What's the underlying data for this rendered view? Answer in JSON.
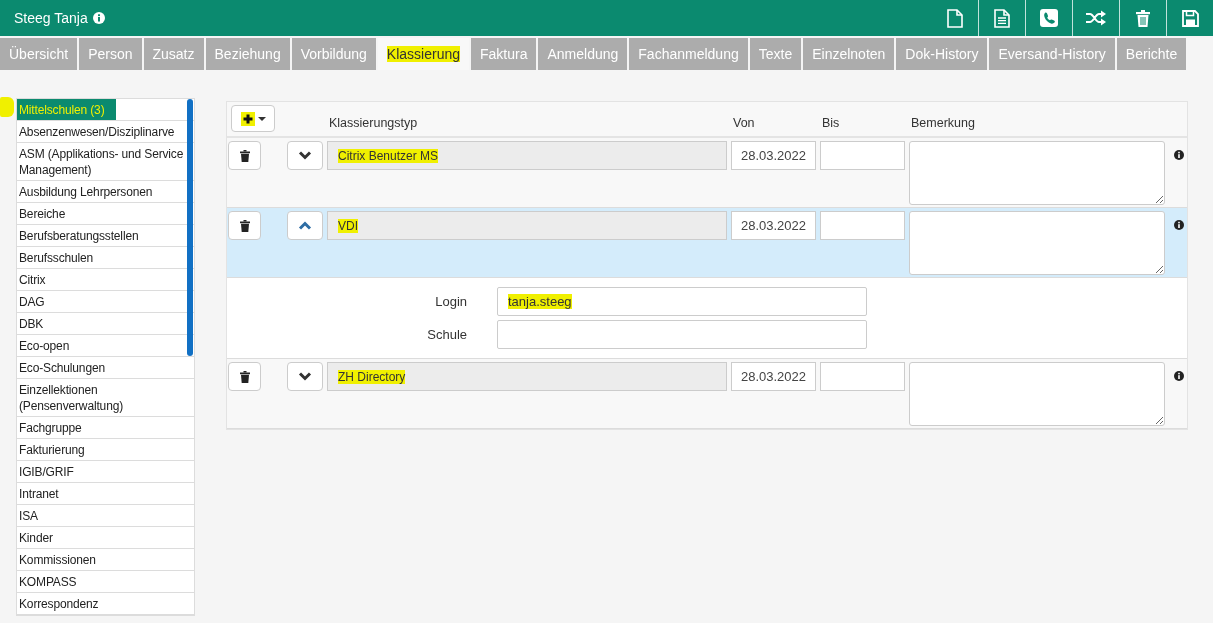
{
  "header": {
    "title": "Steeg Tanja"
  },
  "tabs": [
    {
      "label": "Übersicht",
      "selected": false,
      "highlighted": false
    },
    {
      "label": "Person",
      "selected": false,
      "highlighted": false
    },
    {
      "label": "Zusatz",
      "selected": false,
      "highlighted": false
    },
    {
      "label": "Beziehung",
      "selected": false,
      "highlighted": false
    },
    {
      "label": "Vorbildung",
      "selected": false,
      "highlighted": false
    },
    {
      "label": "Klassierung",
      "selected": true,
      "highlighted": true
    },
    {
      "label": "Faktura",
      "selected": false,
      "highlighted": false
    },
    {
      "label": "Anmeldung",
      "selected": false,
      "highlighted": false
    },
    {
      "label": "Fachanmeldung",
      "selected": false,
      "highlighted": false
    },
    {
      "label": "Texte",
      "selected": false,
      "highlighted": false
    },
    {
      "label": "Einzelnoten",
      "selected": false,
      "highlighted": false
    },
    {
      "label": "Dok-History",
      "selected": false,
      "highlighted": false
    },
    {
      "label": "Eversand-History",
      "selected": false,
      "highlighted": false
    },
    {
      "label": "Berichte",
      "selected": false,
      "highlighted": false
    }
  ],
  "sidebar": {
    "items": [
      {
        "label": "Mittelschulen (3)",
        "selected": true,
        "highlighted": true
      },
      {
        "label": "Absenzenwesen/Disziplinarve",
        "selected": false,
        "highlighted": false
      },
      {
        "label": "ASM (Applikations- und Service Management)",
        "selected": false,
        "highlighted": false
      },
      {
        "label": "Ausbildung Lehrpersonen",
        "selected": false,
        "highlighted": false
      },
      {
        "label": "Bereiche",
        "selected": false,
        "highlighted": false
      },
      {
        "label": "Berufsberatungsstellen",
        "selected": false,
        "highlighted": false
      },
      {
        "label": "Berufsschulen",
        "selected": false,
        "highlighted": false
      },
      {
        "label": "Citrix",
        "selected": false,
        "highlighted": false
      },
      {
        "label": "DAG",
        "selected": false,
        "highlighted": false
      },
      {
        "label": "DBK",
        "selected": false,
        "highlighted": false
      },
      {
        "label": "Eco-open",
        "selected": false,
        "highlighted": false
      },
      {
        "label": "Eco-Schulungen",
        "selected": false,
        "highlighted": false
      },
      {
        "label": "Einzellektionen (Pensenverwaltung)",
        "selected": false,
        "highlighted": false
      },
      {
        "label": "Fachgruppe",
        "selected": false,
        "highlighted": false
      },
      {
        "label": "Fakturierung",
        "selected": false,
        "highlighted": false
      },
      {
        "label": "IGIB/GRIF",
        "selected": false,
        "highlighted": false
      },
      {
        "label": "Intranet",
        "selected": false,
        "highlighted": false
      },
      {
        "label": "ISA",
        "selected": false,
        "highlighted": false
      },
      {
        "label": "Kinder",
        "selected": false,
        "highlighted": false
      },
      {
        "label": "Kommissionen",
        "selected": false,
        "highlighted": false
      },
      {
        "label": "KOMPASS",
        "selected": false,
        "highlighted": false
      },
      {
        "label": "Korrespondenz",
        "selected": false,
        "highlighted": false
      }
    ]
  },
  "classifications": {
    "add_button": {
      "highlighted": true
    },
    "columns": [
      "Klassierungstyp",
      "Von",
      "Bis",
      "Bemerkung"
    ],
    "rows": [
      {
        "type": "Citrix Benutzer MS",
        "from": "28.03.2022",
        "expanded": false,
        "highlighted": true
      },
      {
        "type": "VDI",
        "from": "28.03.2022",
        "expanded": true,
        "highlighted": true,
        "details": [
          {
            "label": "Login",
            "value": "tanja.steeg",
            "highlighted": true
          },
          {
            "label": "Schule"
          }
        ]
      },
      {
        "type": "ZH Directory",
        "from": "28.03.2022",
        "expanded": false,
        "highlighted": true
      }
    ]
  }
}
